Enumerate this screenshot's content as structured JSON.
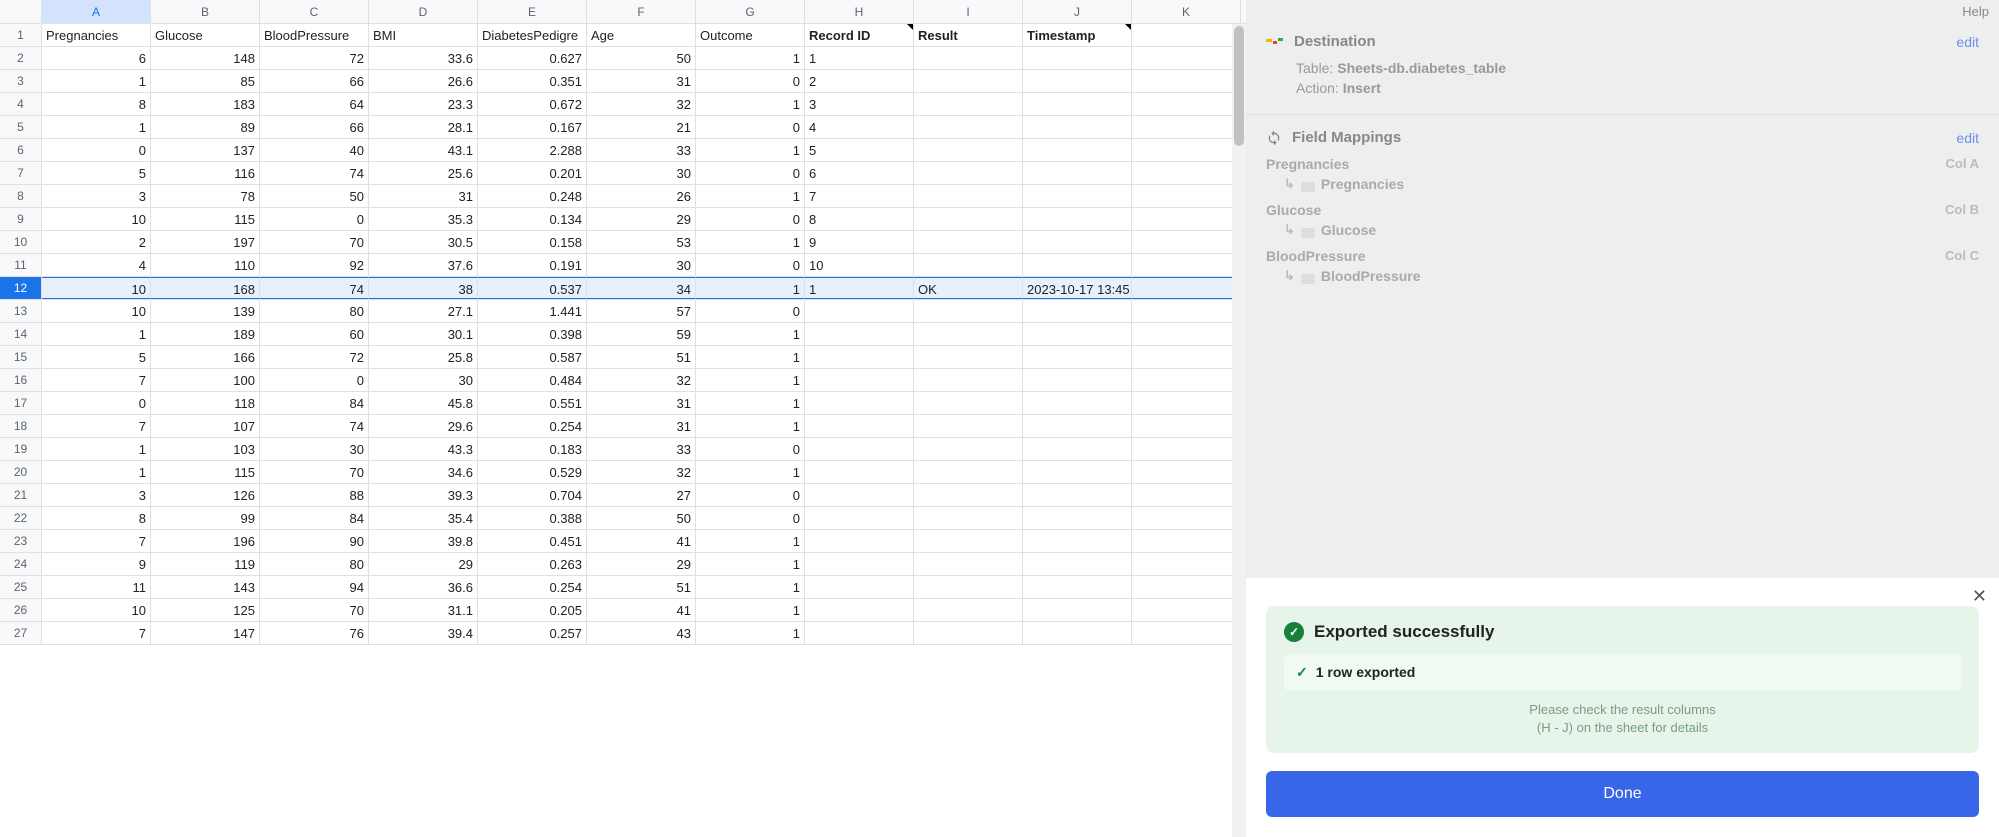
{
  "help_label": "Help",
  "columns": [
    "A",
    "B",
    "C",
    "D",
    "E",
    "F",
    "G",
    "H",
    "I",
    "J",
    "K"
  ],
  "headers": [
    "Pregnancies",
    "Glucose",
    "BloodPressure",
    "BMI",
    "DiabetesPedigre",
    "Age",
    "Outcome",
    "Record ID",
    "Result",
    "Timestamp",
    ""
  ],
  "bold_headers": [
    false,
    false,
    false,
    false,
    false,
    false,
    false,
    true,
    true,
    true,
    false
  ],
  "note_headers": [
    false,
    false,
    false,
    false,
    false,
    false,
    false,
    true,
    false,
    true,
    false
  ],
  "selected_row_index": 11,
  "selected_col_index": 0,
  "rows": [
    {
      "n": 1,
      "c": [
        "Pregnancies",
        "Glucose",
        "BloodPressure",
        "BMI",
        "DiabetesPedigre",
        "Age",
        "Outcome",
        "Record ID",
        "Result",
        "Timestamp",
        ""
      ]
    },
    {
      "n": 2,
      "c": [
        "6",
        "148",
        "72",
        "33.6",
        "0.627",
        "50",
        "1",
        "1",
        "",
        "",
        ""
      ]
    },
    {
      "n": 3,
      "c": [
        "1",
        "85",
        "66",
        "26.6",
        "0.351",
        "31",
        "0",
        "2",
        "",
        "",
        ""
      ]
    },
    {
      "n": 4,
      "c": [
        "8",
        "183",
        "64",
        "23.3",
        "0.672",
        "32",
        "1",
        "3",
        "",
        "",
        ""
      ]
    },
    {
      "n": 5,
      "c": [
        "1",
        "89",
        "66",
        "28.1",
        "0.167",
        "21",
        "0",
        "4",
        "",
        "",
        ""
      ]
    },
    {
      "n": 6,
      "c": [
        "0",
        "137",
        "40",
        "43.1",
        "2.288",
        "33",
        "1",
        "5",
        "",
        "",
        ""
      ]
    },
    {
      "n": 7,
      "c": [
        "5",
        "116",
        "74",
        "25.6",
        "0.201",
        "30",
        "0",
        "6",
        "",
        "",
        ""
      ]
    },
    {
      "n": 8,
      "c": [
        "3",
        "78",
        "50",
        "31",
        "0.248",
        "26",
        "1",
        "7",
        "",
        "",
        ""
      ]
    },
    {
      "n": 9,
      "c": [
        "10",
        "115",
        "0",
        "35.3",
        "0.134",
        "29",
        "0",
        "8",
        "",
        "",
        ""
      ]
    },
    {
      "n": 10,
      "c": [
        "2",
        "197",
        "70",
        "30.5",
        "0.158",
        "53",
        "1",
        "9",
        "",
        "",
        ""
      ]
    },
    {
      "n": 11,
      "c": [
        "4",
        "110",
        "92",
        "37.6",
        "0.191",
        "30",
        "0",
        "10",
        "",
        "",
        ""
      ]
    },
    {
      "n": 12,
      "c": [
        "10",
        "168",
        "74",
        "38",
        "0.537",
        "34",
        "1",
        "1",
        "OK",
        "2023-10-17 13:45",
        ""
      ]
    },
    {
      "n": 13,
      "c": [
        "10",
        "139",
        "80",
        "27.1",
        "1.441",
        "57",
        "0",
        "",
        "",
        "",
        ""
      ]
    },
    {
      "n": 14,
      "c": [
        "1",
        "189",
        "60",
        "30.1",
        "0.398",
        "59",
        "1",
        "",
        "",
        "",
        ""
      ]
    },
    {
      "n": 15,
      "c": [
        "5",
        "166",
        "72",
        "25.8",
        "0.587",
        "51",
        "1",
        "",
        "",
        "",
        ""
      ]
    },
    {
      "n": 16,
      "c": [
        "7",
        "100",
        "0",
        "30",
        "0.484",
        "32",
        "1",
        "",
        "",
        "",
        ""
      ]
    },
    {
      "n": 17,
      "c": [
        "0",
        "118",
        "84",
        "45.8",
        "0.551",
        "31",
        "1",
        "",
        "",
        "",
        ""
      ]
    },
    {
      "n": 18,
      "c": [
        "7",
        "107",
        "74",
        "29.6",
        "0.254",
        "31",
        "1",
        "",
        "",
        "",
        ""
      ]
    },
    {
      "n": 19,
      "c": [
        "1",
        "103",
        "30",
        "43.3",
        "0.183",
        "33",
        "0",
        "",
        "",
        "",
        ""
      ]
    },
    {
      "n": 20,
      "c": [
        "1",
        "115",
        "70",
        "34.6",
        "0.529",
        "32",
        "1",
        "",
        "",
        "",
        ""
      ]
    },
    {
      "n": 21,
      "c": [
        "3",
        "126",
        "88",
        "39.3",
        "0.704",
        "27",
        "0",
        "",
        "",
        "",
        ""
      ]
    },
    {
      "n": 22,
      "c": [
        "8",
        "99",
        "84",
        "35.4",
        "0.388",
        "50",
        "0",
        "",
        "",
        "",
        ""
      ]
    },
    {
      "n": 23,
      "c": [
        "7",
        "196",
        "90",
        "39.8",
        "0.451",
        "41",
        "1",
        "",
        "",
        "",
        ""
      ]
    },
    {
      "n": 24,
      "c": [
        "9",
        "119",
        "80",
        "29",
        "0.263",
        "29",
        "1",
        "",
        "",
        "",
        ""
      ]
    },
    {
      "n": 25,
      "c": [
        "11",
        "143",
        "94",
        "36.6",
        "0.254",
        "51",
        "1",
        "",
        "",
        "",
        ""
      ]
    },
    {
      "n": 26,
      "c": [
        "10",
        "125",
        "70",
        "31.1",
        "0.205",
        "41",
        "1",
        "",
        "",
        "",
        ""
      ]
    },
    {
      "n": 27,
      "c": [
        "7",
        "147",
        "76",
        "39.4",
        "0.257",
        "43",
        "1",
        "",
        "",
        "",
        ""
      ]
    }
  ],
  "sidebar": {
    "destination": {
      "title": "Destination",
      "edit": "edit",
      "table_label": "Table:",
      "table_value": "Sheets-db.diabetes_table",
      "action_label": "Action:",
      "action_value": "Insert"
    },
    "mappings": {
      "title": "Field Mappings",
      "edit": "edit",
      "items": [
        {
          "src": "Pregnancies",
          "col": "Col A",
          "dest": "Pregnancies"
        },
        {
          "src": "Glucose",
          "col": "Col B",
          "dest": "Glucose"
        },
        {
          "src": "BloodPressure",
          "col": "Col C",
          "dest": "BloodPressure"
        }
      ]
    },
    "success": {
      "title": "Exported successfully",
      "row_msg": "1 row exported",
      "hint1": "Please check the result columns",
      "hint2": "(H - J) on the sheet for details",
      "done": "Done"
    }
  }
}
